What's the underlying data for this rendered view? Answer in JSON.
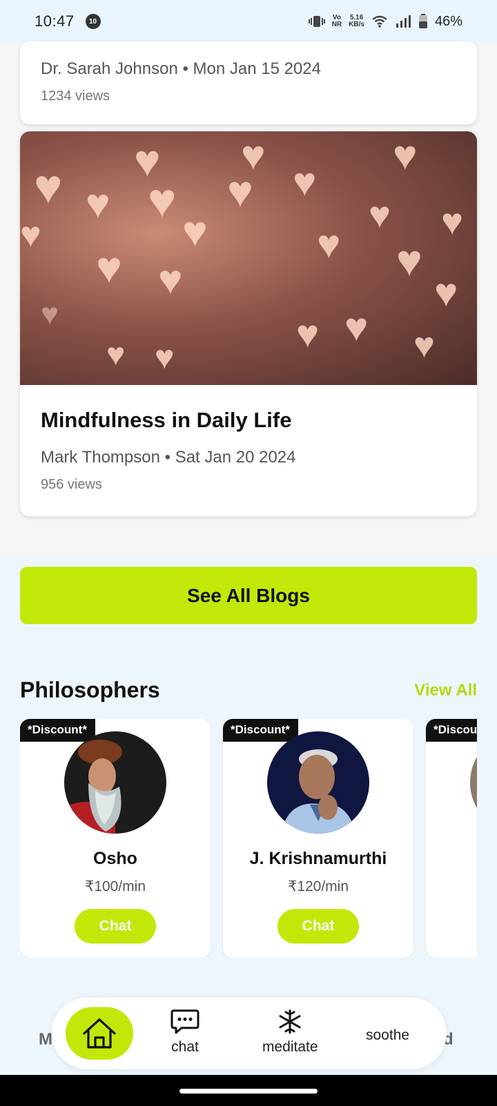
{
  "status_bar": {
    "time": "10:47",
    "notification_badge": "10",
    "network_line1": "Vo",
    "network_line2": "NR",
    "speed_line1": "5.16",
    "speed_line2": "KB/s",
    "battery": "46%"
  },
  "blogs": [
    {
      "author_date": "Dr. Sarah Johnson • Mon Jan 15 2024",
      "views": "1234 views"
    },
    {
      "title": "Mindfulness in Daily Life",
      "author_date": "Mark Thompson • Sat Jan 20 2024",
      "views": "956 views"
    }
  ],
  "see_all_blogs": "See All Blogs",
  "philosophers_section": {
    "title": "Philosophers",
    "view_all": "View All",
    "items": [
      {
        "discount": "*Discount*",
        "name": "Osho",
        "price": "₹100/min",
        "chat": "Chat"
      },
      {
        "discount": "*Discount*",
        "name": "J. Krishnamurthi",
        "price": "₹120/min",
        "chat": "Chat"
      },
      {
        "discount": "*Discou"
      }
    ]
  },
  "bottom_nav": {
    "behind_left": "M",
    "behind_right": "d",
    "items": [
      {
        "label": "",
        "icon": "home-icon",
        "active": true
      },
      {
        "label": "chat",
        "icon": "chat-icon"
      },
      {
        "label": "meditate",
        "icon": "meditate-icon"
      },
      {
        "label": "soothe",
        "icon": ""
      }
    ]
  },
  "colors": {
    "accent": "#c2e80a",
    "view_all": "#b6d80c",
    "background": "#eef6fd"
  }
}
